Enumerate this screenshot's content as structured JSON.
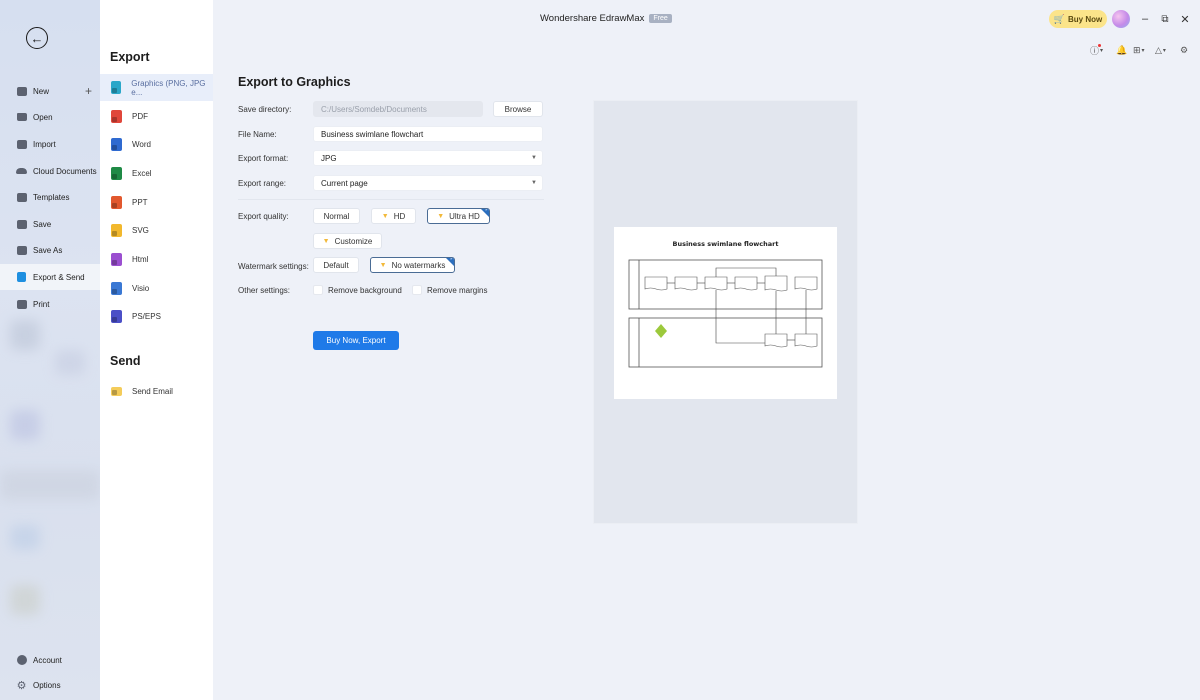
{
  "app": {
    "title": "Wondershare EdrawMax",
    "badge": "Free",
    "buy_now": "Buy Now"
  },
  "left_nav": {
    "items": [
      {
        "label": "New",
        "icon": "new-icon"
      },
      {
        "label": "Open",
        "icon": "folder-icon"
      },
      {
        "label": "Import",
        "icon": "import-icon"
      },
      {
        "label": "Cloud Documents",
        "icon": "cloud-icon"
      },
      {
        "label": "Templates",
        "icon": "templates-icon"
      },
      {
        "label": "Save",
        "icon": "save-icon"
      },
      {
        "label": "Save As",
        "icon": "save-as-icon"
      },
      {
        "label": "Export & Send",
        "icon": "export-icon",
        "active": true
      },
      {
        "label": "Print",
        "icon": "print-icon"
      }
    ],
    "bottom": [
      {
        "label": "Account",
        "icon": "account-icon"
      },
      {
        "label": "Options",
        "icon": "gear-icon"
      }
    ]
  },
  "export_menu": {
    "export_heading": "Export",
    "items": [
      {
        "label": "Graphics (PNG, JPG e...",
        "color": "#2aa7c9",
        "active": true
      },
      {
        "label": "PDF",
        "color": "#e0463a"
      },
      {
        "label": "Word",
        "color": "#2f6ad0"
      },
      {
        "label": "Excel",
        "color": "#1f8a45"
      },
      {
        "label": "PPT",
        "color": "#e2582e"
      },
      {
        "label": "SVG",
        "color": "#f2b82d"
      },
      {
        "label": "Html",
        "color": "#9b4fd0"
      },
      {
        "label": "Visio",
        "color": "#3a78d4"
      },
      {
        "label": "PS/EPS",
        "color": "#4b4fc7"
      }
    ],
    "send_heading": "Send",
    "send_items": [
      {
        "label": "Send Email",
        "color": "#f4cc5a"
      }
    ]
  },
  "form": {
    "title": "Export to Graphics",
    "save_directory_label": "Save directory:",
    "save_directory_value": "C:/Users/Somdeb/Documents",
    "browse": "Browse",
    "file_name_label": "File Name:",
    "file_name_value": "Business swimlane flowchart",
    "format_label": "Export format:",
    "format_value": "JPG",
    "range_label": "Export range:",
    "range_value": "Current page",
    "quality_label": "Export quality:",
    "quality_options": [
      "Normal",
      "HD",
      "Ultra HD",
      "Customize"
    ],
    "quality_selected": "Ultra HD",
    "watermark_label": "Watermark settings:",
    "watermark_options": [
      "Default",
      "No watermarks"
    ],
    "watermark_selected": "No watermarks",
    "other_label": "Other settings:",
    "remove_background": "Remove background",
    "remove_background_checked": false,
    "remove_margins": "Remove margins",
    "remove_margins_checked": false,
    "export_button": "Buy Now, Export"
  },
  "preview": {
    "diagram_title": "Business swimlane flowchart"
  }
}
